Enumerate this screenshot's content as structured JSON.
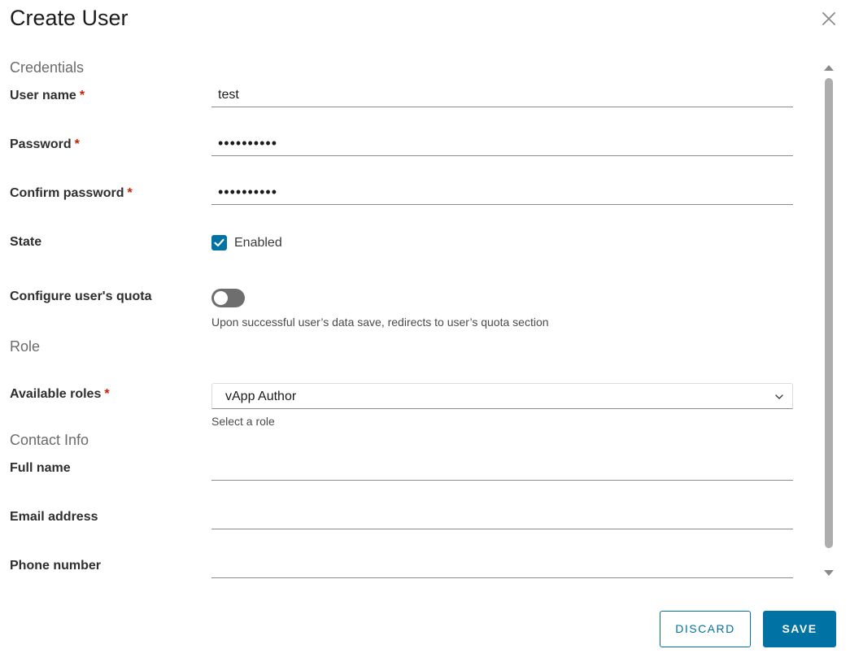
{
  "dialog": {
    "title": "Create User",
    "close_icon": "close-icon"
  },
  "credentials": {
    "section_title": "Credentials",
    "username": {
      "label": "User name",
      "required_mark": "*",
      "value": "test"
    },
    "password": {
      "label": "Password",
      "required_mark": "*",
      "value": "••••••••••"
    },
    "confirm_password": {
      "label": "Confirm password",
      "required_mark": "*",
      "value": "••••••••••"
    },
    "state": {
      "label": "State",
      "checkbox_label": "Enabled",
      "checked": true
    },
    "quota": {
      "label": "Configure user's quota",
      "enabled": false,
      "helper": "Upon successful user’s data save, redirects to user’s quota section"
    }
  },
  "role": {
    "section_title": "Role",
    "available_roles": {
      "label": "Available roles",
      "required_mark": "*",
      "selected": "vApp Author",
      "helper": "Select a role"
    }
  },
  "contact": {
    "section_title": "Contact Info",
    "full_name": {
      "label": "Full name",
      "value": ""
    },
    "email": {
      "label": "Email address",
      "value": ""
    },
    "phone": {
      "label": "Phone number",
      "value": ""
    }
  },
  "footer": {
    "discard_label": "DISCARD",
    "save_label": "SAVE"
  },
  "colors": {
    "accent": "#0072a3",
    "required": "#c92100",
    "toggle_off": "#6e6e6e"
  }
}
